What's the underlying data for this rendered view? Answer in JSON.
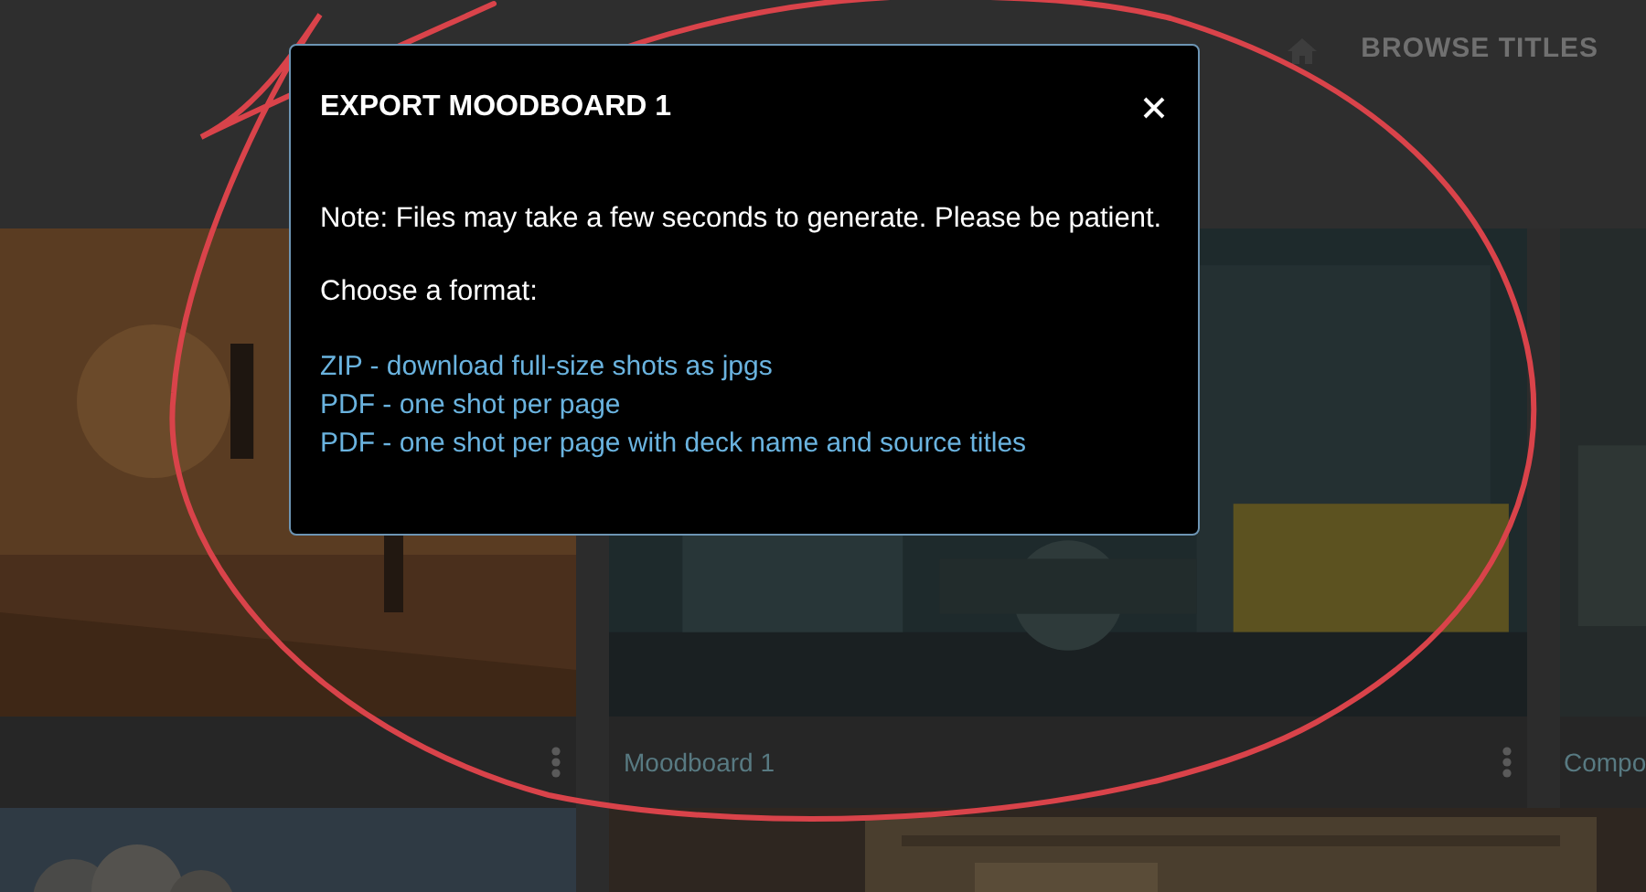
{
  "header": {
    "nav_label": "BROWSE TITLES"
  },
  "cards": [
    {
      "kind": "picture"
    },
    {
      "kind": "picture",
      "title": "Moodboard 1"
    },
    {
      "kind": "picture",
      "title": "Compo"
    }
  ],
  "second_row": [
    {
      "kind": "picture"
    },
    {
      "kind": "picture"
    }
  ],
  "dialog": {
    "title": "EXPORT MOODBOARD 1",
    "note": "Note: Files may take a few seconds to generate. Please be patient.",
    "prompt": "Choose a format:",
    "options": [
      "ZIP - download full-size shots as jpgs",
      "PDF - one shot per page",
      "PDF - one shot per page with deck name and source titles"
    ]
  }
}
